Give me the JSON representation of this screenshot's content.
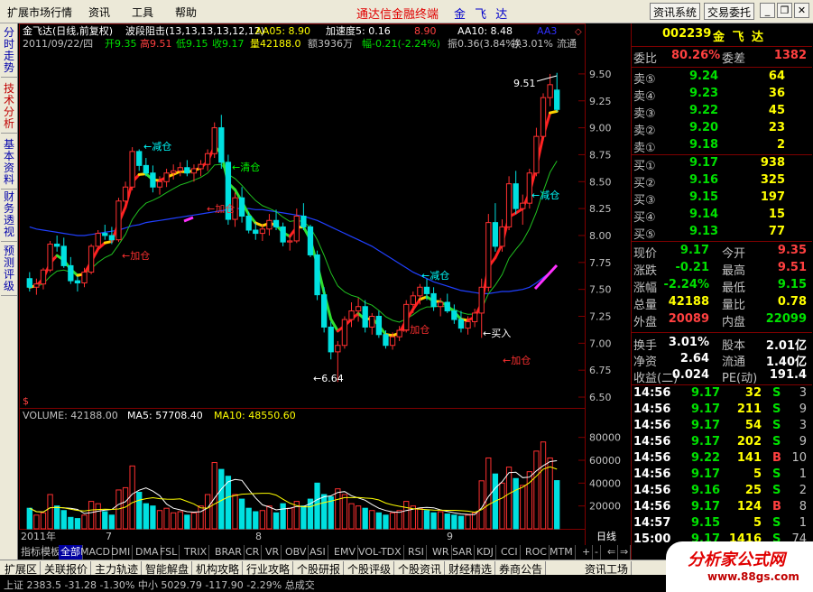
{
  "menu": {
    "items": [
      "扩展市场行情",
      "资讯",
      "工具",
      "帮助"
    ],
    "app_title": "通达信金融终端",
    "stock_name": "金 飞 达",
    "buttons": [
      "资讯系统",
      "交易委托"
    ]
  },
  "left_tabs": [
    "分时走势",
    "技术分析",
    "基本资料",
    "财务透视",
    "预测评级"
  ],
  "chart": {
    "title_name": "金飞达(日线,前复权)",
    "indicator_name": "波段阻击(13,13,13,13,12,12)",
    "aa05": "AA05: 8.90",
    "speed": "加速度5: 0.16",
    "aa8": "8.90",
    "aa10": "AA10: 8.48",
    "aa3": "AA3",
    "info_date": "2011/09/22/四",
    "info_open": "开9.35",
    "info_high": "高9.51",
    "info_low": "低9.15",
    "info_close": "收9.17",
    "info_vol": "量42188.0",
    "info_amount": "额3936万",
    "info_change": "幅-0.21(-2.24%)",
    "info_amp": "振0.36(3.84%)",
    "info_turnover": "换3.01%",
    "info_flow": "流通",
    "price_axis": [
      "9.50",
      "9.25",
      "9.00",
      "8.75",
      "8.50",
      "8.25",
      "8.00",
      "7.75",
      "7.50",
      "7.25",
      "7.00",
      "6.75",
      "6.50"
    ],
    "vol_axis": [
      "80000",
      "60000",
      "40000",
      "20000"
    ],
    "x_labels": [
      "2011年",
      "7",
      "8",
      "9"
    ],
    "period": "日线",
    "annotations": {
      "jiancang": "←减仓",
      "qingcang": "←清仓",
      "jiacang": "←加仓",
      "mairu": "←买入",
      "high_mark": "9.51",
      "low_mark": "←6.64"
    },
    "volume_header": {
      "volume": "VOLUME: 42188.00",
      "ma5": "MA5: 57708.40",
      "ma10": "MA10: 48550.60"
    },
    "dollar": "$"
  },
  "chart_data": {
    "type": "candlestick",
    "ohlc": [
      [
        7.6,
        7.66,
        7.48,
        7.52
      ],
      [
        7.52,
        7.6,
        7.45,
        7.55
      ],
      [
        7.55,
        7.7,
        7.5,
        7.68
      ],
      [
        7.68,
        7.95,
        7.66,
        7.92
      ],
      [
        7.92,
        8.0,
        7.85,
        7.9
      ],
      [
        7.9,
        7.98,
        7.7,
        7.72
      ],
      [
        7.72,
        7.8,
        7.55,
        7.58
      ],
      [
        7.58,
        7.62,
        7.48,
        7.56
      ],
      [
        7.56,
        7.7,
        7.52,
        7.66
      ],
      [
        7.66,
        7.92,
        7.64,
        7.9
      ],
      [
        7.9,
        8.05,
        7.88,
        8.02
      ],
      [
        8.02,
        8.1,
        7.96,
        8.0
      ],
      [
        8.0,
        8.08,
        7.92,
        7.96
      ],
      [
        7.96,
        8.35,
        7.94,
        8.32
      ],
      [
        8.32,
        8.5,
        8.28,
        8.45
      ],
      [
        8.45,
        8.82,
        8.42,
        8.78
      ],
      [
        8.78,
        8.8,
        8.6,
        8.65
      ],
      [
        8.65,
        8.72,
        8.55,
        8.58
      ],
      [
        8.58,
        8.65,
        8.4,
        8.45
      ],
      [
        8.45,
        8.55,
        8.38,
        8.5
      ],
      [
        8.5,
        8.62,
        8.45,
        8.58
      ],
      [
        8.58,
        8.66,
        8.52,
        8.6
      ],
      [
        8.6,
        8.68,
        8.55,
        8.63
      ],
      [
        8.63,
        8.7,
        8.55,
        8.58
      ],
      [
        8.58,
        8.66,
        8.5,
        8.62
      ],
      [
        8.62,
        8.7,
        8.55,
        8.66
      ],
      [
        8.66,
        8.8,
        8.6,
        8.76
      ],
      [
        8.76,
        9.05,
        8.72,
        9.0
      ],
      [
        9.0,
        9.12,
        8.62,
        8.68
      ],
      [
        8.68,
        8.75,
        8.1,
        8.15
      ],
      [
        8.15,
        8.4,
        8.08,
        8.35
      ],
      [
        8.35,
        8.45,
        8.12,
        8.18
      ],
      [
        8.18,
        8.22,
        8.02,
        8.05
      ],
      [
        8.05,
        8.12,
        7.96,
        8.02
      ],
      [
        8.02,
        8.1,
        7.95,
        8.06
      ],
      [
        8.06,
        8.2,
        8.0,
        8.14
      ],
      [
        8.14,
        8.24,
        8.05,
        8.08
      ],
      [
        8.08,
        8.12,
        7.9,
        7.94
      ],
      [
        7.94,
        8.0,
        7.86,
        7.95
      ],
      [
        7.95,
        8.25,
        7.93,
        8.18
      ],
      [
        8.18,
        8.3,
        8.05,
        8.08
      ],
      [
        8.08,
        8.1,
        7.8,
        7.82
      ],
      [
        7.82,
        7.86,
        7.4,
        7.45
      ],
      [
        7.45,
        7.52,
        7.1,
        7.15
      ],
      [
        7.15,
        7.2,
        6.85,
        6.92
      ],
      [
        6.92,
        7.02,
        6.64,
        6.98
      ],
      [
        6.98,
        7.25,
        6.95,
        7.22
      ],
      [
        7.22,
        7.38,
        7.15,
        7.3
      ],
      [
        7.3,
        7.42,
        7.2,
        7.34
      ],
      [
        7.34,
        7.4,
        7.1,
        7.15
      ],
      [
        7.15,
        7.28,
        7.08,
        7.25
      ],
      [
        7.25,
        7.3,
        7.05,
        7.08
      ],
      [
        7.08,
        7.12,
        6.95,
        6.98
      ],
      [
        6.98,
        7.1,
        6.94,
        7.06
      ],
      [
        7.06,
        7.16,
        7.02,
        7.12
      ],
      [
        7.12,
        7.4,
        7.1,
        7.36
      ],
      [
        7.36,
        7.48,
        7.28,
        7.44
      ],
      [
        7.44,
        7.55,
        7.36,
        7.52
      ],
      [
        7.52,
        7.6,
        7.4,
        7.46
      ],
      [
        7.46,
        7.52,
        7.3,
        7.34
      ],
      [
        7.34,
        7.42,
        7.25,
        7.38
      ],
      [
        7.38,
        7.46,
        7.28,
        7.3
      ],
      [
        7.3,
        7.36,
        7.18,
        7.22
      ],
      [
        7.22,
        7.3,
        7.1,
        7.14
      ],
      [
        7.14,
        7.25,
        7.08,
        7.2
      ],
      [
        7.2,
        7.32,
        7.15,
        7.28
      ],
      [
        7.28,
        7.6,
        7.05,
        7.52
      ],
      [
        7.52,
        8.2,
        7.48,
        8.12
      ],
      [
        8.12,
        8.3,
        7.85,
        7.9
      ],
      [
        7.9,
        8.15,
        7.85,
        8.08
      ],
      [
        8.08,
        8.55,
        8.05,
        8.48
      ],
      [
        8.48,
        8.6,
        8.2,
        8.25
      ],
      [
        8.25,
        8.38,
        8.1,
        8.3
      ],
      [
        8.3,
        8.62,
        8.25,
        8.58
      ],
      [
        8.58,
        9.0,
        8.55,
        8.92
      ],
      [
        8.92,
        9.32,
        8.88,
        9.28
      ],
      [
        9.28,
        9.5,
        9.2,
        9.4
      ],
      [
        9.35,
        9.51,
        9.15,
        9.17
      ]
    ],
    "volume": [
      18000,
      12000,
      14000,
      30000,
      20000,
      16000,
      10000,
      9000,
      12000,
      24000,
      22000,
      15000,
      12000,
      34000,
      36000,
      55000,
      32000,
      22000,
      20000,
      16000,
      18000,
      14000,
      15000,
      12000,
      14000,
      20000,
      30000,
      58000,
      52000,
      46000,
      30000,
      26000,
      18000,
      15000,
      16000,
      20000,
      14000,
      22000,
      18000,
      24000,
      20000,
      26000,
      40000,
      30000,
      28000,
      35000,
      30000,
      22000,
      20000,
      18000,
      16000,
      14000,
      12000,
      14000,
      16000,
      24000,
      20000,
      18000,
      16000,
      14000,
      15000,
      13000,
      12000,
      11000,
      12000,
      14000,
      42000,
      62000,
      48000,
      40000,
      54000,
      44000,
      38000,
      50000,
      68000,
      76000,
      62000,
      42188
    ],
    "ma_blue": [
      8.08,
      8.06,
      8.05,
      8.04,
      8.03,
      8.02,
      8.01,
      8.0,
      8.0,
      8.01,
      8.02,
      8.03,
      8.04,
      8.05,
      8.07,
      8.09,
      8.1,
      8.12,
      8.13,
      8.14,
      8.15,
      8.16,
      8.17,
      8.18,
      8.19,
      8.2,
      8.21,
      8.22,
      8.23,
      8.24,
      8.25,
      8.25,
      8.25,
      8.24,
      8.24,
      8.23,
      8.22,
      8.21,
      8.2,
      8.19,
      8.18,
      8.16,
      8.14,
      8.11,
      8.08,
      8.05,
      8.02,
      7.99,
      7.96,
      7.93,
      7.9,
      7.86,
      7.82,
      7.78,
      7.74,
      7.7,
      7.66,
      7.63,
      7.6,
      7.57,
      7.55,
      7.53,
      7.51,
      7.49,
      7.48,
      7.47,
      7.46,
      7.46,
      7.47,
      7.48,
      7.48,
      7.49,
      7.5,
      7.52,
      7.56,
      7.61,
      7.66,
      7.72
    ],
    "yaxis_range": [
      6.45,
      9.65
    ],
    "volume_range": [
      0,
      90000
    ]
  },
  "quote": {
    "code": "002239",
    "name": "金 飞 达",
    "weibi_label": "委比",
    "weibi": "80.26%",
    "weicha_label": "委差",
    "weicha": "1382",
    "asks": [
      {
        "label": "卖⑤",
        "price": "9.24",
        "vol": "64"
      },
      {
        "label": "卖④",
        "price": "9.23",
        "vol": "36"
      },
      {
        "label": "卖③",
        "price": "9.22",
        "vol": "45"
      },
      {
        "label": "卖②",
        "price": "9.20",
        "vol": "23"
      },
      {
        "label": "卖①",
        "price": "9.18",
        "vol": "2"
      }
    ],
    "bids": [
      {
        "label": "买①",
        "price": "9.17",
        "vol": "938"
      },
      {
        "label": "买②",
        "price": "9.16",
        "vol": "325"
      },
      {
        "label": "买③",
        "price": "9.15",
        "vol": "197"
      },
      {
        "label": "买④",
        "price": "9.14",
        "vol": "15"
      },
      {
        "label": "买⑤",
        "price": "9.13",
        "vol": "77"
      }
    ],
    "stats": [
      {
        "l1": "现价",
        "v1": "9.17",
        "c1": "green",
        "l2": "今开",
        "v2": "9.35",
        "c2": "red"
      },
      {
        "l1": "涨跌",
        "v1": "-0.21",
        "c1": "green",
        "l2": "最高",
        "v2": "9.51",
        "c2": "red"
      },
      {
        "l1": "涨幅",
        "v1": "-2.24%",
        "c1": "green",
        "l2": "最低",
        "v2": "9.15",
        "c2": "green"
      },
      {
        "l1": "总量",
        "v1": "42188",
        "c1": "yellow",
        "l2": "量比",
        "v2": "0.78",
        "c2": "yellow"
      },
      {
        "l1": "外盘",
        "v1": "20089",
        "c1": "red",
        "l2": "内盘",
        "v2": "22099",
        "c2": "green"
      }
    ],
    "stats2": [
      {
        "l1": "换手",
        "v1": "3.01%",
        "l2": "股本",
        "v2": "2.01亿"
      },
      {
        "l1": "净资",
        "v1": "2.64",
        "l2": "流通",
        "v2": "1.40亿"
      },
      {
        "l1": "收益(二)",
        "v1": "0.024",
        "l2": "PE(动)",
        "v2": "191.4"
      }
    ],
    "ticks": [
      {
        "t": "14:56",
        "p": "9.17",
        "pc": "green",
        "v": "32",
        "s": "S",
        "sc": "green",
        "n": "3"
      },
      {
        "t": "14:56",
        "p": "9.17",
        "pc": "green",
        "v": "211",
        "s": "S",
        "sc": "green",
        "n": "9"
      },
      {
        "t": "14:56",
        "p": "9.17",
        "pc": "green",
        "v": "54",
        "s": "S",
        "sc": "green",
        "n": "3"
      },
      {
        "t": "14:56",
        "p": "9.17",
        "pc": "green",
        "v": "202",
        "s": "S",
        "sc": "green",
        "n": "9"
      },
      {
        "t": "14:56",
        "p": "9.22",
        "pc": "green",
        "v": "141",
        "s": "B",
        "sc": "red",
        "n": "10"
      },
      {
        "t": "14:56",
        "p": "9.17",
        "pc": "green",
        "v": "5",
        "s": "S",
        "sc": "green",
        "n": "1"
      },
      {
        "t": "14:56",
        "p": "9.16",
        "pc": "green",
        "v": "25",
        "s": "S",
        "sc": "green",
        "n": "2"
      },
      {
        "t": "14:56",
        "p": "9.17",
        "pc": "green",
        "v": "124",
        "s": "B",
        "sc": "red",
        "n": "8"
      },
      {
        "t": "14:57",
        "p": "9.15",
        "pc": "green",
        "v": "5",
        "s": "S",
        "sc": "green",
        "n": "1"
      },
      {
        "t": "15:00",
        "p": "9.17",
        "pc": "green",
        "v": "1416",
        "s": "S",
        "sc": "green",
        "n": "74"
      }
    ]
  },
  "indicator_tabs": [
    "指标",
    "模板",
    "全部",
    "MACD",
    "DMI",
    "DMA",
    "FSL",
    "TRIX",
    "BRAR",
    "CR",
    "VR",
    "OBV",
    "ASI",
    "EMV",
    "VOL-TDX",
    "RSI",
    "WR",
    "SAR",
    "KDJ",
    "CCI",
    "ROC",
    "MTM"
  ],
  "bottom_tabs": [
    "扩展区",
    "关联报价",
    "主力轨迹",
    "智能解盘",
    "机构攻略",
    "行业攻略",
    "个股研报",
    "个股评级",
    "个股资讯",
    "财经精选",
    "券商公告",
    "资讯工场"
  ],
  "status_text": "上证 2383.5 -31.28 -1.30% 中小 5029.79 -117.90 -2.29% 总成交",
  "logo": {
    "line1": "分析家公式网",
    "line2": "www.88gs.com"
  }
}
